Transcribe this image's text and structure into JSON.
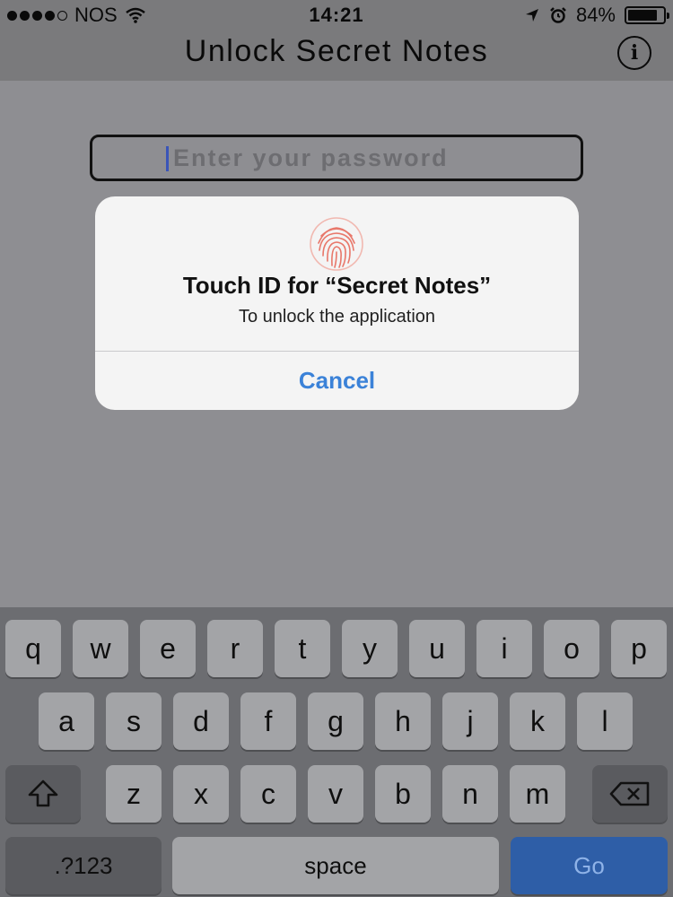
{
  "status_bar": {
    "carrier": "NOS",
    "time": "14:21",
    "battery_percent": "84%",
    "battery_level": 0.84,
    "icons": [
      "signal-dots-icon",
      "wifi-icon",
      "location-arrow-icon",
      "alarm-clock-icon",
      "battery-icon"
    ]
  },
  "nav": {
    "title": "Unlock Secret Notes",
    "info_label": "i"
  },
  "password_field": {
    "placeholder": "Enter your password"
  },
  "alert": {
    "icon": "fingerprint-icon",
    "title": "Touch ID for “Secret Notes”",
    "message": "To unlock the application",
    "cancel_label": "Cancel"
  },
  "keyboard": {
    "row1": [
      "q",
      "w",
      "e",
      "r",
      "t",
      "y",
      "u",
      "i",
      "o",
      "p"
    ],
    "row2": [
      "a",
      "s",
      "d",
      "f",
      "g",
      "h",
      "j",
      "k",
      "l"
    ],
    "row3": [
      "z",
      "x",
      "c",
      "v",
      "b",
      "n",
      "m"
    ],
    "numbers_label": ".?123",
    "space_label": "space",
    "go_label": "Go",
    "icons": [
      "shift-icon",
      "backspace-icon"
    ]
  },
  "colors": {
    "accent": "#3b82d8",
    "go_key": "#2e5ea7"
  }
}
